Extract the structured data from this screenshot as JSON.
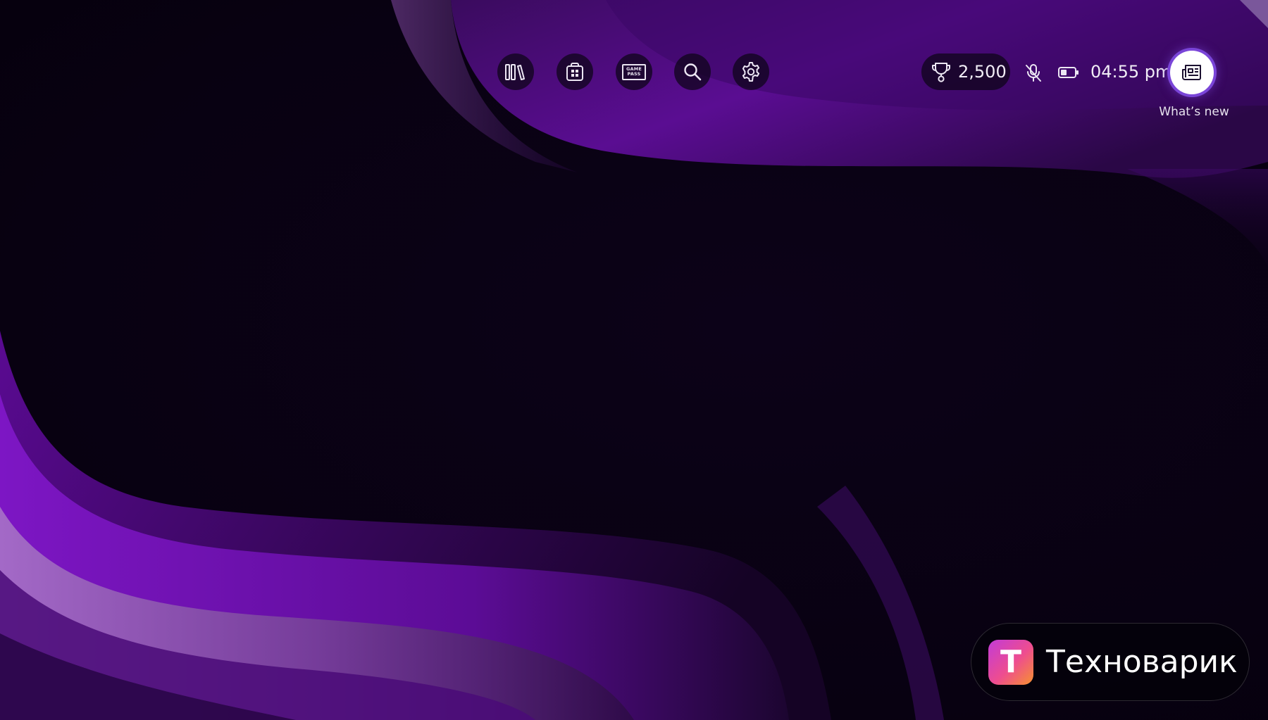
{
  "nav": {
    "buttons": [
      {
        "id": "library",
        "icon": "library-icon"
      },
      {
        "id": "store",
        "icon": "store-icon"
      },
      {
        "id": "game-pass",
        "icon": "game-pass-icon",
        "badge_line1": "GAME",
        "badge_line2": "PASS"
      },
      {
        "id": "search",
        "icon": "search-icon"
      },
      {
        "id": "settings",
        "icon": "gear-icon"
      }
    ]
  },
  "status": {
    "points": "2,500",
    "points_icon": "rewards-trophy-icon",
    "mic_icon": "mic-muted-icon",
    "battery_icon": "battery-icon",
    "time": "04:55 pm"
  },
  "whats_new": {
    "label": "What’s new",
    "icon": "news-icon"
  },
  "watermark": {
    "logo_letter": "Т",
    "name": "Техноварик"
  },
  "colors": {
    "background": "#08010f",
    "wave_purple": "#6a10a8",
    "focus_ring": "#7a45d8",
    "text": "#f1edf6"
  }
}
